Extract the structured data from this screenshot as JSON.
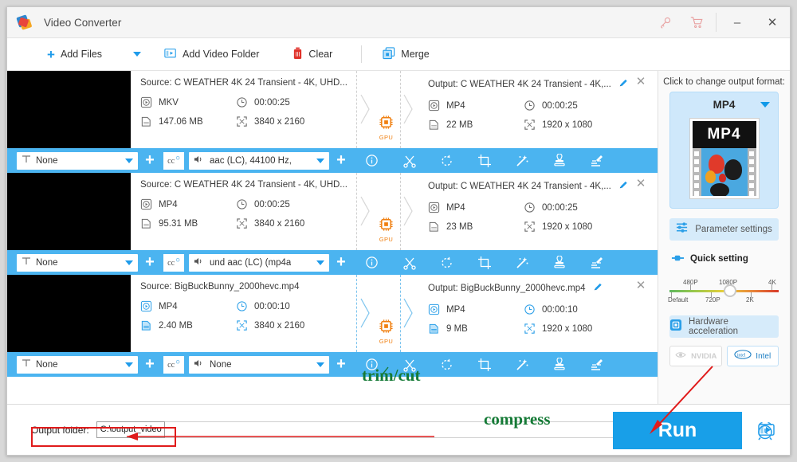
{
  "window": {
    "title": "Video Converter",
    "logo_icon": "app-logo-icon",
    "key_icon": "key-icon",
    "cart_icon": "cart-icon",
    "minimize_label": "–",
    "close_label": "✕"
  },
  "toolbar": {
    "add_files_label": "Add Files",
    "add_files_icon": "plus-icon",
    "add_files_caret_icon": "chevron-down-icon",
    "add_video_folder_label": "Add Video Folder",
    "add_video_folder_icon": "folder-video-icon",
    "clear_label": "Clear",
    "clear_icon": "trash-icon",
    "merge_label": "Merge",
    "merge_icon": "merge-squares-icon"
  },
  "files": [
    {
      "source_title": "Source: C  WEATHER  4K 24  Transient - 4K, UHD...",
      "source_format": "MKV",
      "source_duration": "00:00:25",
      "source_size": "147.06 MB",
      "source_resolution": "3840 x 2160",
      "gpu_label": "GPU",
      "output_title": "Output: C  WEATHER  4K 24  Transient - 4K,...",
      "output_format": "MP4",
      "output_duration": "00:00:25",
      "output_size": "22 MB",
      "output_resolution": "1920 x 1080",
      "subtitle_value": "None",
      "audio_value": "aac (LC), 44100 Hz,"
    },
    {
      "source_title": "Source: C  WEATHER  4K 24  Transient - 4K, UHD...",
      "source_format": "MP4",
      "source_duration": "00:00:25",
      "source_size": "95.31 MB",
      "source_resolution": "3840 x 2160",
      "gpu_label": "GPU",
      "output_title": "Output: C  WEATHER  4K 24  Transient - 4K,...",
      "output_format": "MP4",
      "output_duration": "00:00:25",
      "output_size": "23 MB",
      "output_resolution": "1920 x 1080",
      "subtitle_value": "None",
      "audio_value": "und aac (LC) (mp4a"
    },
    {
      "source_title": "Source: BigBuckBunny_2000hevc.mp4",
      "source_format": "MP4",
      "source_duration": "00:00:10",
      "source_size": "2.40 MB",
      "source_resolution": "3840 x 2160",
      "gpu_label": "GPU",
      "output_title": "Output: BigBuckBunny_2000hevc.mp4",
      "output_format": "MP4",
      "output_duration": "00:00:10",
      "output_size": "9 MB",
      "output_resolution": "1920 x 1080",
      "subtitle_value": "None",
      "audio_value": "None"
    }
  ],
  "row_actions": {
    "subtitle_icon": "subtitle-T-icon",
    "add_subtitle_icon": "plus-icon",
    "cc_icon": "closed-caption-icon",
    "audio_icon": "speaker-icon",
    "add_audio_icon": "plus-icon",
    "info_icon": "info-icon",
    "trim_icon": "scissors-icon",
    "rotate_icon": "rotate-icon",
    "crop_icon": "crop-icon",
    "effect_icon": "magic-wand-icon",
    "watermark_icon": "stamp-icon",
    "subtitle_edit_icon": "subtitle-edit-icon"
  },
  "sidebar": {
    "heading": "Click to change output format:",
    "format_name": "MP4",
    "format_thumb_label": "MP4",
    "format_caret_icon": "chevron-down-icon",
    "parameter_settings_label": "Parameter settings",
    "parameter_settings_icon": "sliders-icon",
    "quick_setting_label": "Quick setting",
    "quick_setting_icon": "toggle-icon",
    "quality_ticks_top": [
      "480P",
      "1080P",
      "4K"
    ],
    "quality_ticks_bottom": [
      "Default",
      "720P",
      "2K"
    ],
    "quality_selected": "1080P",
    "hardware_acceleration_label": "Hardware acceleration",
    "hardware_acceleration_icon": "chip-icon",
    "nvidia_label": "NVIDIA",
    "nvidia_icon": "nvidia-eye-icon",
    "nvidia_enabled": false,
    "intel_label": "Intel",
    "intel_icon": "intel-logo-icon",
    "intel_enabled": true
  },
  "bottom": {
    "output_folder_label": "Output folder:",
    "output_folder_value": "C:\\output_video",
    "output_folder_caret_icon": "chevron-down-icon",
    "open_folder_icon": "folder-open-icon",
    "compress_icon": "compress-video-icon",
    "run_label": "Run",
    "timer_icon": "alarm-clock-icon"
  },
  "annotations": {
    "trim_cut": "trim/cut",
    "compress": "compress"
  },
  "colors": {
    "accent_blue": "#189fe8",
    "bar_blue": "#4bb4f0",
    "gpu_orange": "#f08012",
    "annotation_green": "#157a36",
    "highlight_red": "#e01b1b"
  }
}
